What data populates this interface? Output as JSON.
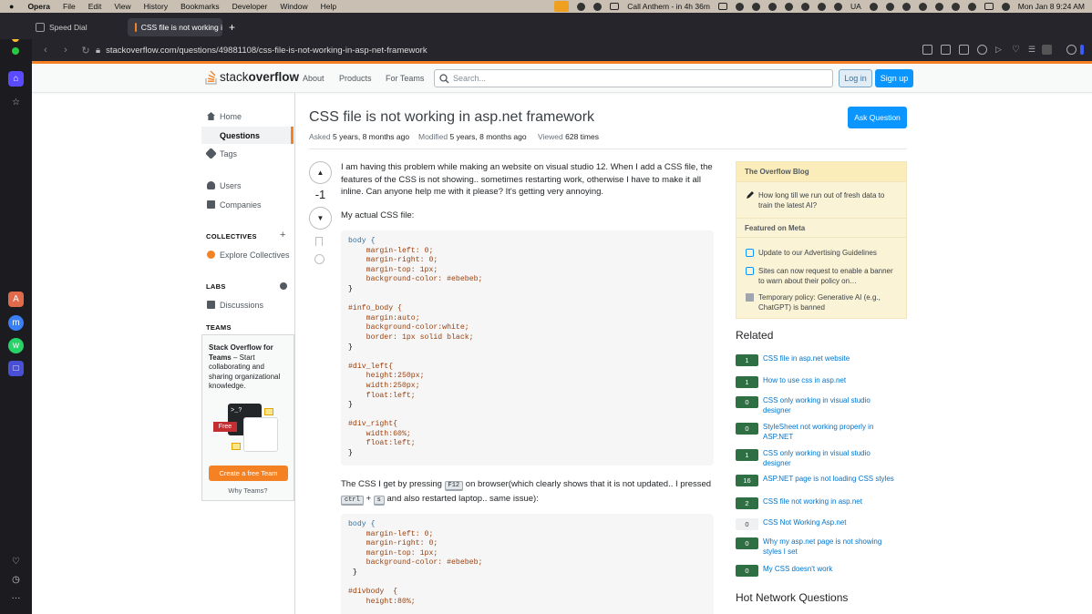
{
  "menubar": {
    "apple": "",
    "items": [
      "Opera",
      "File",
      "Edit",
      "View",
      "History",
      "Bookmarks",
      "Developer",
      "Window",
      "Help"
    ],
    "call": "Call Anthem - in 4h 36m",
    "lang": "UA",
    "datetime": "Mon Jan 8  9:24 AM"
  },
  "browser": {
    "tabs": [
      {
        "label": "Speed Dial"
      },
      {
        "label": "CSS file is not working i"
      }
    ],
    "url": "stackoverflow.com/questions/49881108/css-file-is-not-working-in-asp-net-framework"
  },
  "so": {
    "logo_a": "stack",
    "logo_b": "overflow",
    "nav": [
      "About",
      "Products",
      "For Teams"
    ],
    "search_placeholder": "Search...",
    "login": "Log in",
    "signup": "Sign up"
  },
  "leftnav": {
    "home": "Home",
    "questions": "Questions",
    "tags": "Tags",
    "users": "Users",
    "companies": "Companies",
    "collectives_head": "COLLECTIVES",
    "explore": "Explore Collectives",
    "labs_head": "LABS",
    "discussions": "Discussions",
    "teams_head": "TEAMS",
    "teams_title": "Stack Overflow for Teams",
    "teams_desc": " – Start collaborating and sharing organizational knowledge.",
    "free": "Free",
    "create_team": "Create a free Team",
    "why_teams": "Why Teams?"
  },
  "question": {
    "title": "CSS file is not working in asp.net framework",
    "asked_label": "Asked",
    "asked": "5 years, 8 months ago",
    "modified_label": "Modified",
    "modified": "5 years, 8 months ago",
    "viewed_label": "Viewed",
    "viewed": "628 times",
    "ask_button": "Ask Question",
    "score": "-1",
    "p1": "I am having this problem while making an website on visual studio 12. When I add a CSS file, the features of the CSS is not showing.. sometimes restarting work, otherwise I have to make it all inline. Can anyone help me with it please? It's getting very annoying.",
    "p2": "My actual CSS file:",
    "p3_a": "The CSS I get by pressing ",
    "kbd_f12": "F12",
    "p3_b": " on browser(which clearly shows that it is not updated.. I pressed ",
    "kbd_ctrl": "ctrl",
    "plus": "+",
    "kbd_s": "s",
    "p3_c": " and also restarted laptop.. same issue):",
    "code1": [
      "body {",
      "    margin-left: 0;",
      "    margin-right: 0;",
      "    margin-top: 1px;",
      "    background-color: #ebebeb;",
      "}",
      "",
      "#info_body {",
      "    margin:auto;",
      "    background-color:white;",
      "    border: 1px solid black;",
      "}",
      "",
      "#div_left{",
      "    height:250px;",
      "    width:250px;",
      "    float:left;",
      "}",
      "",
      "#div_right{",
      "    width:60%;",
      "    float:left;",
      "}"
    ],
    "code2": [
      "body {",
      "    margin-left: 0;",
      "    margin-right: 0;",
      "    margin-top: 1px;",
      "    background-color: #ebebeb;",
      " }",
      "",
      "#divbody  {",
      "    height:80%;"
    ]
  },
  "sidebar": {
    "blog_head": "The Overflow Blog",
    "blog_items": [
      "How long till we run out of fresh data to train the latest AI?"
    ],
    "meta_head": "Featured on Meta",
    "meta_items": [
      "Update to our Advertising Guidelines",
      "Sites can now request to enable a banner to warn about their policy on…",
      "Temporary policy: Generative AI (e.g., ChatGPT) is banned"
    ],
    "related_head": "Related",
    "related": [
      {
        "score": "1",
        "title": "CSS file in asp.net website"
      },
      {
        "score": "1",
        "title": "How to use css in asp.net"
      },
      {
        "score": "0",
        "title": "CSS only working in visual studio designer"
      },
      {
        "score": "0",
        "title": "StyleSheet not working properly in ASP.NET"
      },
      {
        "score": "1",
        "title": "CSS only working in visual studio designer"
      },
      {
        "score": "16",
        "title": "ASP.NET page is not loading CSS styles"
      },
      {
        "score": "2",
        "title": "CSS file not working in asp.net"
      },
      {
        "score": "0",
        "title": "CSS Not Working Asp.net"
      },
      {
        "score": "0",
        "title": "Why my asp.net page is not showing styles I set"
      },
      {
        "score": "0",
        "title": "My CSS doesn't work"
      }
    ],
    "hot_head": "Hot Network Questions"
  }
}
